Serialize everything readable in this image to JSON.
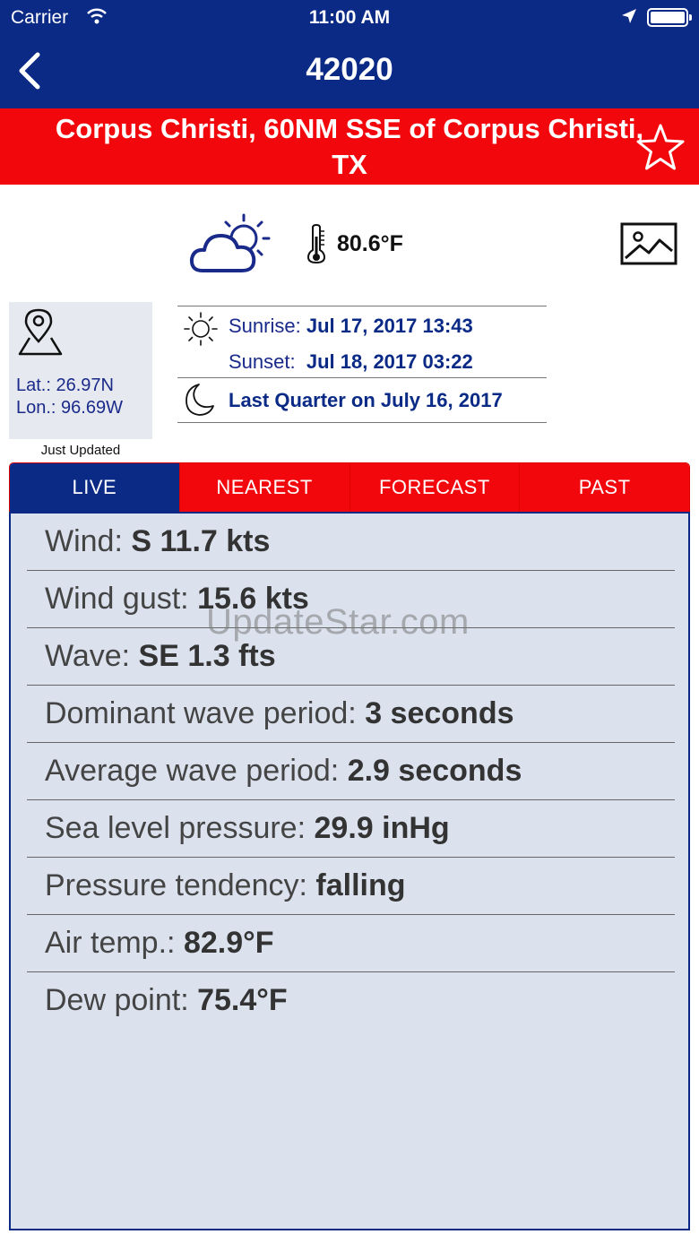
{
  "status_bar": {
    "carrier": "Carrier",
    "time": "11:00 AM"
  },
  "nav": {
    "title": "42020"
  },
  "station": {
    "name": "Corpus Christi, 60NM SSE of Corpus Christi, TX"
  },
  "weather": {
    "temperature": "80.6°F"
  },
  "location": {
    "lat_label": "Lat.:",
    "lat_value": "26.97N",
    "lon_label": "Lon.:",
    "lon_value": "96.69W",
    "updated": "Just Updated"
  },
  "astro": {
    "sunrise_label": "Sunrise:",
    "sunrise_value": "Jul 17, 2017 13:43",
    "sunset_label": "Sunset:",
    "sunset_value": "Jul 18, 2017 03:22",
    "moon": "Last Quarter on July 16, 2017"
  },
  "tabs": [
    {
      "label": "LIVE"
    },
    {
      "label": "NEAREST"
    },
    {
      "label": "FORECAST"
    },
    {
      "label": "PAST"
    }
  ],
  "observations": [
    {
      "label": "Wind:",
      "value": "S 11.7 kts"
    },
    {
      "label": "Wind gust:",
      "value": "15.6 kts"
    },
    {
      "label": "Wave:",
      "value": "SE 1.3 fts"
    },
    {
      "label": "Dominant wave period:",
      "value": "3 seconds"
    },
    {
      "label": "Average wave period:",
      "value": "2.9 seconds"
    },
    {
      "label": "Sea level pressure:",
      "value": "29.9 inHg"
    },
    {
      "label": "Pressure tendency:",
      "value": "falling"
    },
    {
      "label": "Air temp.:",
      "value": "82.9°F"
    },
    {
      "label": "Dew point:",
      "value": "75.4°F"
    }
  ],
  "watermark": "UpdateStar.com",
  "colors": {
    "nav_blue": "#0a2a86",
    "banner_red": "#f2080c",
    "panel_bg": "#dbe2ee"
  }
}
